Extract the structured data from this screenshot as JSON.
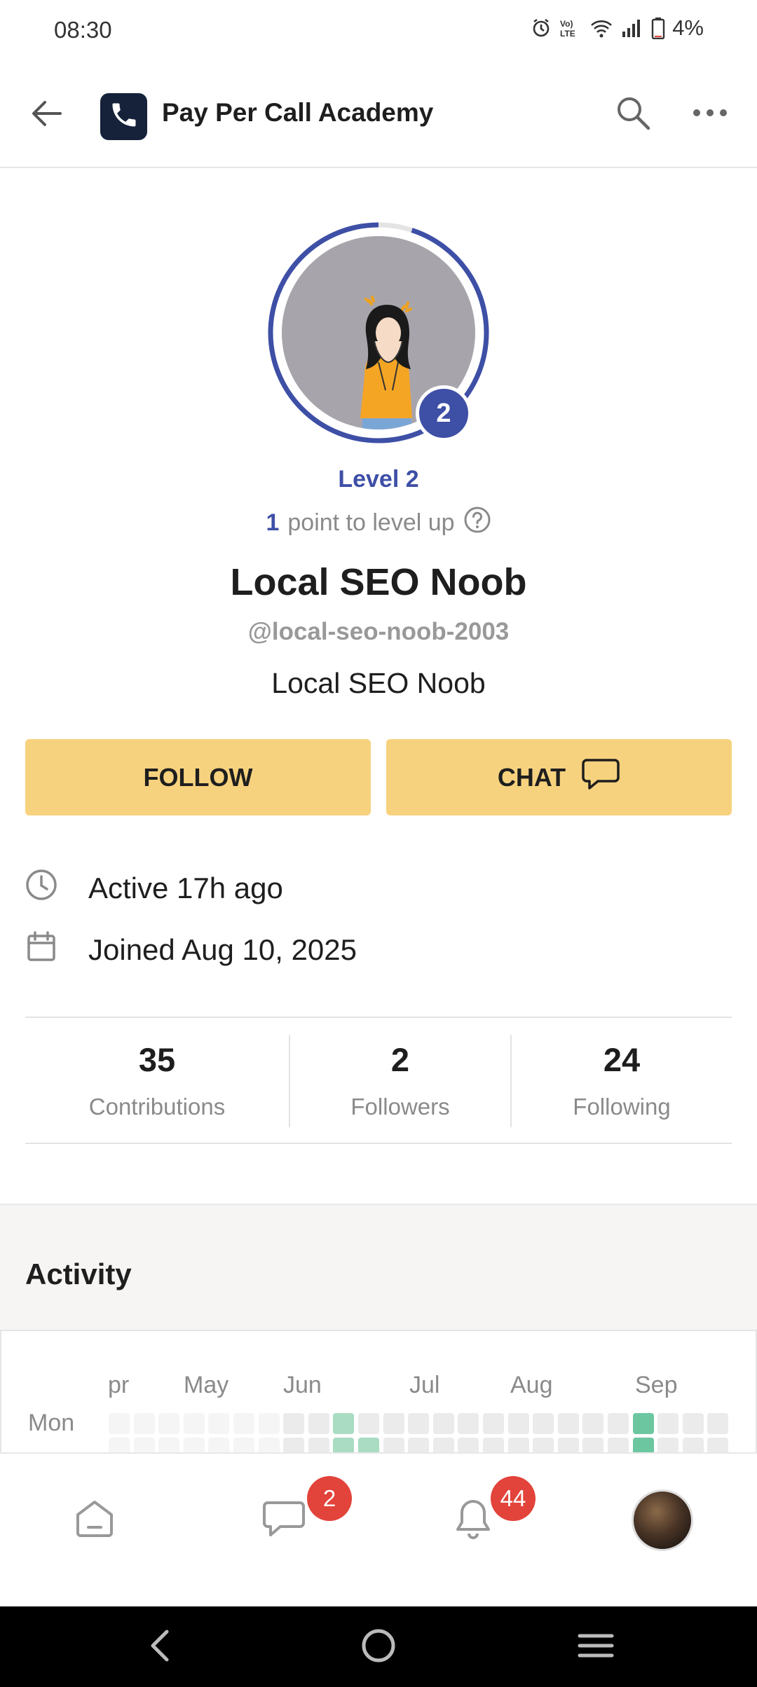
{
  "status_bar": {
    "time": "08:30",
    "battery": "4%",
    "icons": [
      "alarm-icon",
      "volte-icon",
      "wifi-icon",
      "signal-icon",
      "battery-icon"
    ]
  },
  "app_bar": {
    "title": "Pay Per Call Academy",
    "icons": [
      "back-arrow-icon",
      "phone-logo-icon",
      "search-icon",
      "more-icon"
    ]
  },
  "profile": {
    "level_badge": "2",
    "level_label": "Level 2",
    "points_to_level_up": "1",
    "level_up_text": "point to level up",
    "name": "Local SEO Noob",
    "handle": "@local-seo-noob-2003",
    "bio": "Local SEO Noob",
    "level_progress": 0.95
  },
  "actions": {
    "follow_label": "FOLLOW",
    "chat_label": "CHAT"
  },
  "meta": {
    "active": "Active 17h ago",
    "joined": "Joined Aug 10, 2025"
  },
  "stats": [
    {
      "value": "35",
      "label": "Contributions"
    },
    {
      "value": "2",
      "label": "Followers"
    },
    {
      "value": "24",
      "label": "Following"
    }
  ],
  "activity": {
    "title": "Activity",
    "months": [
      "pr",
      "May",
      "Jun",
      "Jul",
      "Aug",
      "Sep"
    ],
    "day_label": "Mon",
    "mon_row_levels": [
      0,
      0,
      0,
      0,
      0,
      0,
      0,
      1,
      1,
      2,
      1,
      1,
      1,
      1,
      1,
      1,
      1,
      1,
      1,
      1,
      1,
      3,
      1,
      1,
      1
    ],
    "next_row_levels": [
      0,
      0,
      0,
      0,
      0,
      0,
      0,
      1,
      1,
      2,
      2,
      1,
      1,
      1,
      1,
      1,
      1,
      1,
      1,
      1,
      1,
      3,
      1,
      1,
      1
    ]
  },
  "bottom_nav": {
    "items": [
      "home-icon",
      "chat-icon",
      "bell-icon",
      "profile-avatar"
    ],
    "chat_badge": "2",
    "notifications_badge": "44"
  },
  "colors": {
    "accent": "#3e4fa6",
    "button": "#f7d27e",
    "badge": "#e2433a",
    "activity_level_3": "#6cc7a0",
    "activity_level_2": "#a9dcc2",
    "activity_level_1": "#ebebeb",
    "activity_level_0": "#f5f5f5"
  }
}
